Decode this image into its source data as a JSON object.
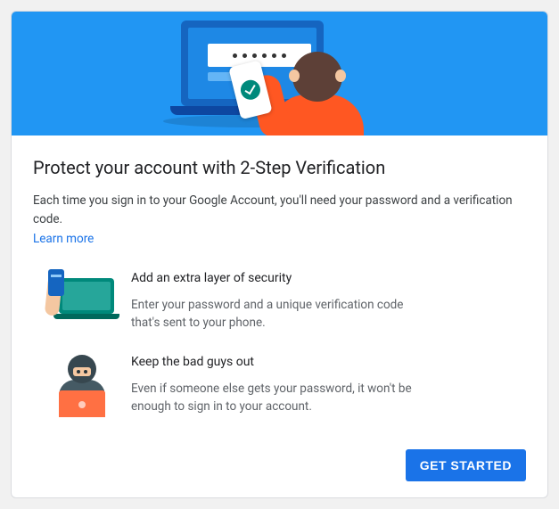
{
  "header": {
    "title": "Protect your account with 2-Step Verification",
    "intro": "Each time you sign in to your Google Account, you'll need your password and a verification code.",
    "learn_more": "Learn more"
  },
  "features": [
    {
      "title": "Add an extra layer of security",
      "desc": "Enter your password and a unique verification code that's sent to your phone."
    },
    {
      "title": "Keep the bad guys out",
      "desc": "Even if someone else gets your password, it won't be enough to sign in to your account."
    }
  ],
  "actions": {
    "get_started": "GET STARTED"
  }
}
